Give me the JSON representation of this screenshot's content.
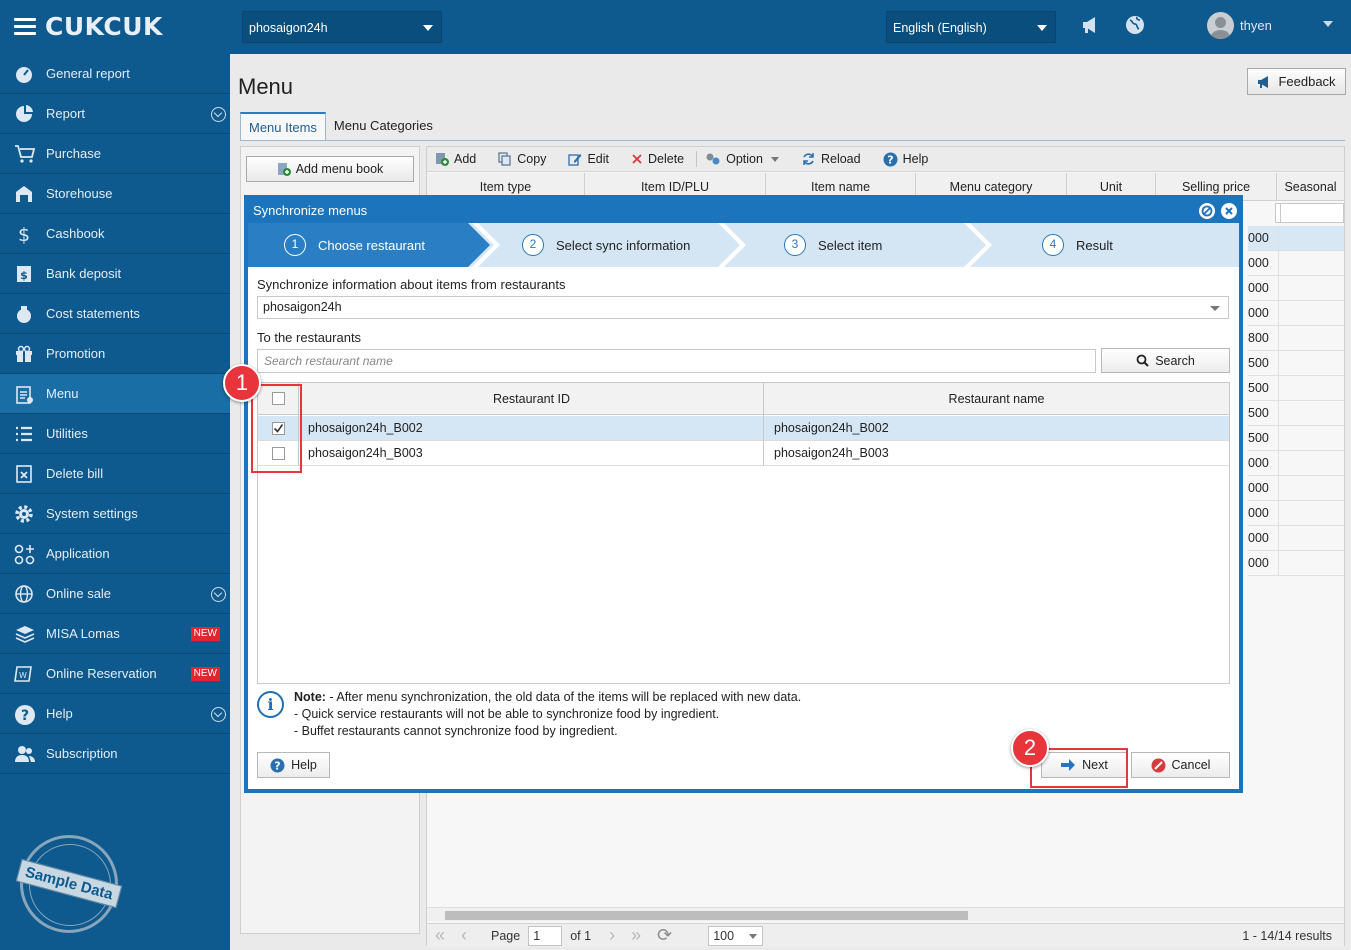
{
  "app": {
    "logo": "CUKCUK"
  },
  "topbar": {
    "restaurant": "phosaigon24h",
    "language": "English (English)",
    "user": "thyen",
    "icons": [
      "megaphone-icon",
      "globe-icon"
    ]
  },
  "sidebar": {
    "items": [
      {
        "label": "General report",
        "icon": "dashboard-icon"
      },
      {
        "label": "Report",
        "icon": "pie-chart-icon",
        "expand": true
      },
      {
        "label": "Purchase",
        "icon": "cart-icon"
      },
      {
        "label": "Storehouse",
        "icon": "storehouse-icon"
      },
      {
        "label": "Cashbook",
        "icon": "dollar-icon"
      },
      {
        "label": "Bank deposit",
        "icon": "bank-icon"
      },
      {
        "label": "Cost statements",
        "icon": "money-bag-icon"
      },
      {
        "label": "Promotion",
        "icon": "gift-icon"
      },
      {
        "label": "Menu",
        "icon": "menu-clipboard-icon",
        "active": true
      },
      {
        "label": "Utilities",
        "icon": "list-icon"
      },
      {
        "label": "Delete bill",
        "icon": "delete-bill-icon"
      },
      {
        "label": "System settings",
        "icon": "gear-icon"
      },
      {
        "label": "Application",
        "icon": "apps-icon"
      },
      {
        "label": "Online sale",
        "icon": "globe-icon",
        "expand": true
      },
      {
        "label": "MISA Lomas",
        "icon": "layers-icon",
        "badge": "NEW"
      },
      {
        "label": "Online Reservation",
        "icon": "reservation-icon",
        "badge": "NEW"
      },
      {
        "label": "Help",
        "icon": "help-icon",
        "expand": true
      },
      {
        "label": "Subscription",
        "icon": "users-icon"
      }
    ],
    "stamp": "Sample Data"
  },
  "page": {
    "title": "Menu",
    "feedback": "Feedback",
    "tabs": [
      {
        "label": "Menu Items",
        "active": true
      },
      {
        "label": "Menu Categories",
        "active": false
      }
    ],
    "add_menu_book": "Add menu book",
    "toolbar": [
      "Add",
      "Copy",
      "Edit",
      "Delete",
      "Option",
      "Reload",
      "Help"
    ],
    "columns": [
      "Item type",
      "Item ID/PLU",
      "Item name",
      "Menu category",
      "Unit",
      "Selling price",
      "Seasonal"
    ],
    "price_fragments": [
      "000",
      "000",
      "000",
      "000",
      "800",
      "500",
      "500",
      "500",
      "500",
      "000",
      "000",
      "000",
      "000",
      "000"
    ],
    "pager": {
      "page_label": "Page",
      "page": "1",
      "of": "of 1",
      "page_size": "100",
      "results": "1 - 14/14 results"
    }
  },
  "dialog": {
    "title": "Synchronize menus",
    "steps": [
      {
        "num": "1",
        "label": "Choose restaurant",
        "active": true
      },
      {
        "num": "2",
        "label": "Select sync information"
      },
      {
        "num": "3",
        "label": "Select item"
      },
      {
        "num": "4",
        "label": "Result"
      }
    ],
    "source_label": "Synchronize information about items from restaurants",
    "source_value": "phosaigon24h",
    "target_label": "To the restaurants",
    "search_placeholder": "Search restaurant name",
    "search_button": "Search",
    "grid_headers": {
      "id": "Restaurant ID",
      "name": "Restaurant name"
    },
    "rows": [
      {
        "id": "phosaigon24h_B002",
        "name": "phosaigon24h_B002",
        "checked": true
      },
      {
        "id": "phosaigon24h_B003",
        "name": "phosaigon24h_B003",
        "checked": false
      }
    ],
    "note_title": "Note:",
    "note_lines": [
      " - After menu synchronization, the old data of the items will be replaced with new data.",
      "- Quick service restaurants will not be able to synchronize food by ingredient.",
      "- Buffet restaurants cannot synchronize food by ingredient."
    ],
    "help_button": "Help",
    "next_button": "Next",
    "cancel_button": "Cancel"
  },
  "annotations": [
    "1",
    "2"
  ],
  "colors": {
    "primary": "#0e5a8f",
    "dialog": "#1b74bc",
    "highlight": "#e8343b"
  }
}
